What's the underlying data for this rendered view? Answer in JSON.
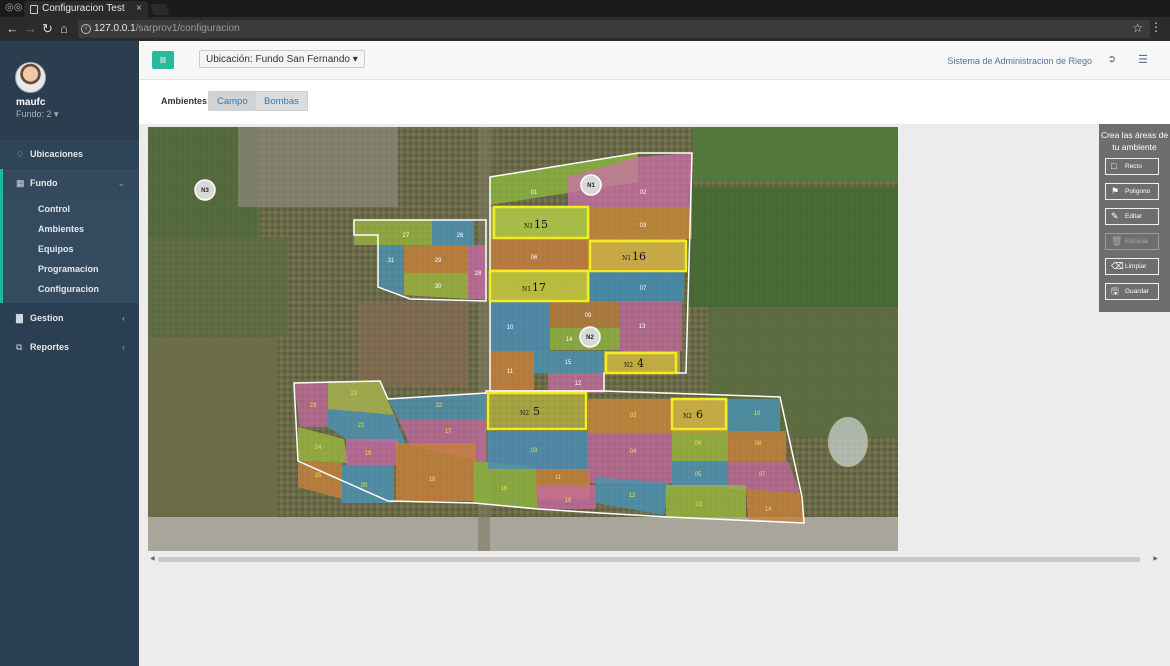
{
  "browser": {
    "tab_title": "Configuracion Test",
    "tab_close": "×",
    "url_host": "127.0.0.1",
    "url_path": "/sarprov1/configuracion",
    "info_glyph": "i"
  },
  "sidebar": {
    "user_name": "maufc",
    "user_fundo": "Fundo: 2 ▾",
    "menu": [
      {
        "label": "Ubicaciones",
        "icon": "diamond-icon"
      },
      {
        "label": "Fundo",
        "icon": "grid-icon"
      },
      {
        "label": "Gestion",
        "icon": "bar-chart-icon"
      },
      {
        "label": "Reportes",
        "icon": "clone-icon"
      }
    ],
    "fundo_sub": [
      "Control",
      "Ambientes",
      "Equipos",
      "Programacion",
      "Configuracion"
    ]
  },
  "topnav": {
    "menu_glyph": "≡",
    "ubicacion_label": "Ubicación: Fundo San Fernando ▾",
    "system_name": "Sistema de Administracion de Riego"
  },
  "ambientes": {
    "label": "Ambientes:",
    "tabs": [
      "Campo",
      "Bombas"
    ]
  },
  "draw_panel": {
    "title": "Crea las áreas de tu ambiente",
    "buttons": [
      "Recto",
      "Poligono",
      "Editar",
      "Eliminar",
      "Limpiar",
      "Guardar"
    ]
  },
  "map": {
    "nodes": [
      "N3",
      "N1",
      "N2"
    ],
    "highlights": [
      {
        "node": "N1",
        "number": "15"
      },
      {
        "node": "N1",
        "number": "16"
      },
      {
        "node": "N1",
        "number": "17"
      },
      {
        "node": "N2",
        "number": "4"
      },
      {
        "node": "N2",
        "number": "5"
      },
      {
        "node": "N2",
        "number": "6"
      }
    ],
    "block_labels": {
      "b01": "01",
      "b02": "02",
      "b03": "03",
      "b06": "06",
      "b07": "07",
      "b09": "09",
      "b10": "10",
      "b11": "11",
      "b12": "12",
      "b13": "13",
      "b14": "14",
      "b15": "15",
      "w26": "26",
      "w27": "27",
      "w28": "28",
      "w29": "29",
      "w30": "30",
      "w31": "31",
      "s01": "01",
      "s02": "02",
      "s03": "03",
      "s04": "04",
      "s05": "05",
      "s06": "06",
      "s07": "07",
      "s08": "08",
      "s10": "10",
      "s11": "11",
      "s12": "12",
      "s13": "13",
      "s14": "14",
      "s15": "15",
      "s16": "16",
      "s17": "17",
      "s18": "18",
      "s19": "19",
      "s20": "20",
      "s21": "21",
      "s22": "22",
      "s23": "23",
      "s24": "24",
      "s25": "25",
      "s32": "32"
    }
  }
}
